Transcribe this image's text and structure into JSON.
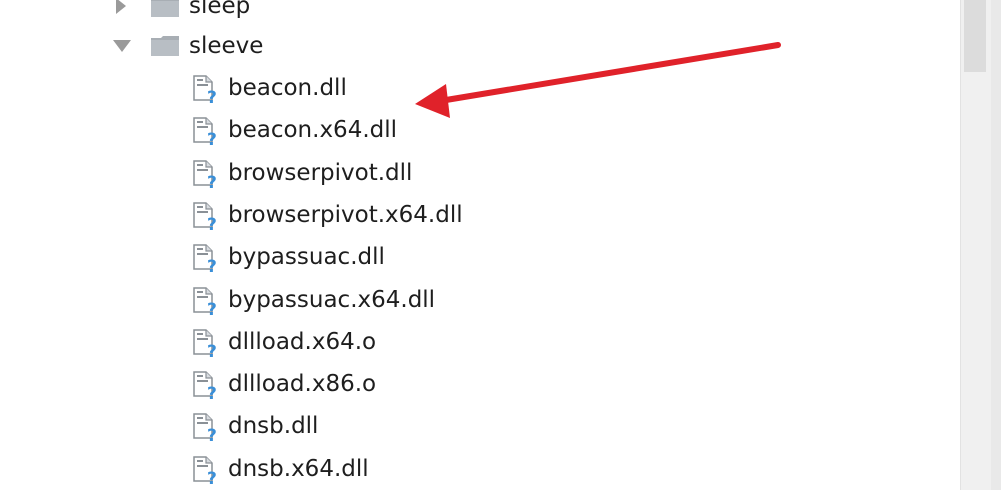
{
  "tree": {
    "folders": [
      {
        "label": "sleep",
        "state": "collapsed"
      },
      {
        "label": "sleeve",
        "state": "expanded"
      }
    ],
    "files": [
      {
        "label": "beacon.dll"
      },
      {
        "label": "beacon.x64.dll"
      },
      {
        "label": "browserpivot.dll"
      },
      {
        "label": "browserpivot.x64.dll"
      },
      {
        "label": "bypassuac.dll"
      },
      {
        "label": "bypassuac.x64.dll"
      },
      {
        "label": "dllload.x64.o"
      },
      {
        "label": "dllload.x86.o"
      },
      {
        "label": "dnsb.dll"
      },
      {
        "label": "dnsb.x64.dll"
      }
    ]
  },
  "icons": {
    "folder": "folder-icon",
    "file": "unknown-file-icon",
    "collapsed_toggle": "chevron-right-icon",
    "expanded_toggle": "chevron-down-icon"
  },
  "colors": {
    "annotation_arrow": "#e0222a",
    "file_question_mark": "#3a8fd8",
    "folder": "#a8aeb4"
  }
}
